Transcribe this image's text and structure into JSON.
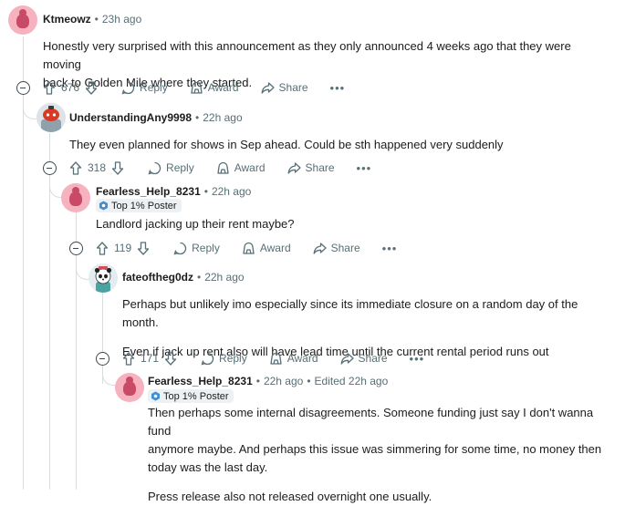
{
  "comments": [
    {
      "author": "Ktmeowz",
      "time": "23h ago",
      "flair": null,
      "edited": null,
      "body": [
        "Honestly very surprised with this announcement as they only announced 4 weeks ago that they were moving",
        "back to Golden Mile where they started."
      ],
      "votes": "676"
    },
    {
      "author": "UnderstandingAny9998",
      "time": "22h ago",
      "flair": null,
      "edited": null,
      "body": [
        "They even planned for shows in Sep ahead. Could be sth happened very suddenly"
      ],
      "votes": "318"
    },
    {
      "author": "Fearless_Help_8231",
      "time": "22h ago",
      "flair": "Top 1% Poster",
      "edited": null,
      "body": [
        "Landlord jacking up their rent maybe?"
      ],
      "votes": "119"
    },
    {
      "author": "fateoftheg0dz",
      "time": "22h ago",
      "flair": null,
      "edited": null,
      "body": [
        "Perhaps but unlikely imo especially since its immediate closure on a random day of the month.",
        "Even if jack up rent also will have lead time until the current rental period runs out"
      ],
      "votes": "171"
    },
    {
      "author": "Fearless_Help_8231",
      "time": "22h ago",
      "flair": "Top 1% Poster",
      "edited": "Edited 22h ago",
      "body": [
        "Then perhaps some internal disagreements. Someone funding just say I don't wanna fund",
        "anymore maybe. And perhaps this issue was simmering for some time, no money then",
        "today was the last day.",
        "Press release also not released overnight one usually."
      ],
      "votes": null
    }
  ],
  "labels": {
    "reply": "Reply",
    "award": "Award",
    "share": "Share",
    "more": "•••",
    "dot": "•"
  },
  "colors": {
    "thread_line": "#d9dde0",
    "meta_text": "#576f76",
    "avatar_pink": "#f7b2bf"
  }
}
